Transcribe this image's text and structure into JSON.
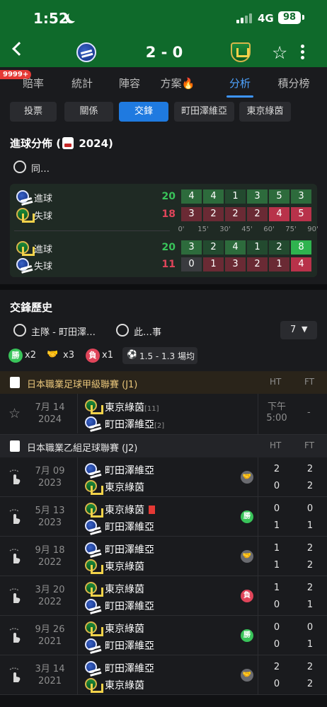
{
  "status_bar": {
    "time": "1:52",
    "network": "4G",
    "battery": "98"
  },
  "header": {
    "score": "2 - 0"
  },
  "badge": "9999+",
  "tabs": [
    "賠率",
    "統計",
    "陣容",
    "方案",
    "分析",
    "積分榜"
  ],
  "active_tab": "分析",
  "subtabs": [
    "投票",
    "關係",
    "交鋒",
    "町田澤維亞",
    "東京綠茵"
  ],
  "active_subtab": "交鋒",
  "goal_dist": {
    "title": "進球分佈 (",
    "year": "2024)",
    "filter_label": "同…",
    "ticks": [
      "0'",
      "15'",
      "30'",
      "45'",
      "60'",
      "75'",
      "90'"
    ],
    "blocks": [
      {
        "rows": [
          {
            "team": "machida",
            "label": "進球",
            "total": "20",
            "color": "#39c45a",
            "values": [
              "4",
              "4",
              "1",
              "3",
              "5",
              "3"
            ],
            "kind": "for"
          },
          {
            "team": "verdy",
            "label": "失球",
            "total": "18",
            "color": "#e0455a",
            "values": [
              "3",
              "2",
              "2",
              "2",
              "4",
              "5"
            ],
            "kind": "against"
          }
        ]
      },
      {
        "rows": [
          {
            "team": "verdy",
            "label": "進球",
            "total": "20",
            "color": "#39c45a",
            "values": [
              "3",
              "2",
              "4",
              "1",
              "2",
              "8"
            ],
            "kind": "for"
          },
          {
            "team": "machida",
            "label": "失球",
            "total": "11",
            "color": "#e0455a",
            "values": [
              "0",
              "1",
              "3",
              "2",
              "1",
              "4"
            ],
            "kind": "against"
          }
        ]
      }
    ]
  },
  "h2h": {
    "title": "交鋒歷史",
    "filter_home": "主隊 - 町田澤…",
    "filter_this": "此…事",
    "count": "7",
    "summary": {
      "win_icon": "勝",
      "win": "x2",
      "draw": "x3",
      "loss_icon": "負",
      "loss": "x1",
      "odds": "1.5 - 1.3 場均"
    },
    "col_ht": "HT",
    "col_ft": "FT",
    "j1": {
      "name": "日本職業足球甲級聯賽 (J1)",
      "match": {
        "month_day": "7月 14",
        "year": "2024",
        "team1": "東京綠茵",
        "team1_rank": "[11]",
        "team2": "町田澤維亞",
        "team2_rank": "[2]",
        "time_label": "下午",
        "time": "5:00",
        "ft": "-"
      }
    },
    "j2": {
      "name": "日本職業乙組足球聯賽 (J2)",
      "matches": [
        {
          "month_day": "7月 09",
          "year": "2023",
          "team1": "町田澤維亞",
          "team1_logo": "machida",
          "team2": "東京綠茵",
          "team2_logo": "verdy",
          "ht1": "2",
          "ht2": "0",
          "ft1": "2",
          "ft2": "2",
          "result": "draw",
          "redcard": false
        },
        {
          "month_day": "5月 13",
          "year": "2023",
          "team1": "東京綠茵",
          "team1_logo": "verdy",
          "team2": "町田澤維亞",
          "team2_logo": "machida",
          "ht1": "0",
          "ht2": "1",
          "ft1": "0",
          "ft2": "1",
          "result": "win",
          "result_label": "勝",
          "redcard": true
        },
        {
          "month_day": "9月 18",
          "year": "2022",
          "team1": "町田澤維亞",
          "team1_logo": "machida",
          "team2": "東京綠茵",
          "team2_logo": "verdy",
          "ht1": "1",
          "ht2": "1",
          "ft1": "2",
          "ft2": "2",
          "result": "draw",
          "redcard": false
        },
        {
          "month_day": "3月 20",
          "year": "2022",
          "team1": "東京綠茵",
          "team1_logo": "verdy",
          "team2": "町田澤維亞",
          "team2_logo": "machida",
          "ht1": "1",
          "ht2": "0",
          "ft1": "2",
          "ft2": "1",
          "result": "loss",
          "result_label": "負",
          "redcard": false
        },
        {
          "month_day": "9月 26",
          "year": "2021",
          "team1": "東京綠茵",
          "team1_logo": "verdy",
          "team2": "町田澤維亞",
          "team2_logo": "machida",
          "ht1": "0",
          "ht2": "0",
          "ft1": "0",
          "ft2": "1",
          "result": "win",
          "result_label": "勝",
          "redcard": false
        },
        {
          "month_day": "3月 14",
          "year": "2021",
          "team1": "町田澤維亞",
          "team1_logo": "machida",
          "team2": "東京綠茵",
          "team2_logo": "verdy",
          "ht1": "2",
          "ht2": "0",
          "ft1": "2",
          "ft2": "2",
          "result": "draw",
          "redcard": false
        }
      ]
    }
  },
  "colors": {
    "header_green": "#0f6a2b",
    "accent_blue": "#1f7ae0",
    "win_green": "#39c45a",
    "loss_red": "#e0455a"
  }
}
